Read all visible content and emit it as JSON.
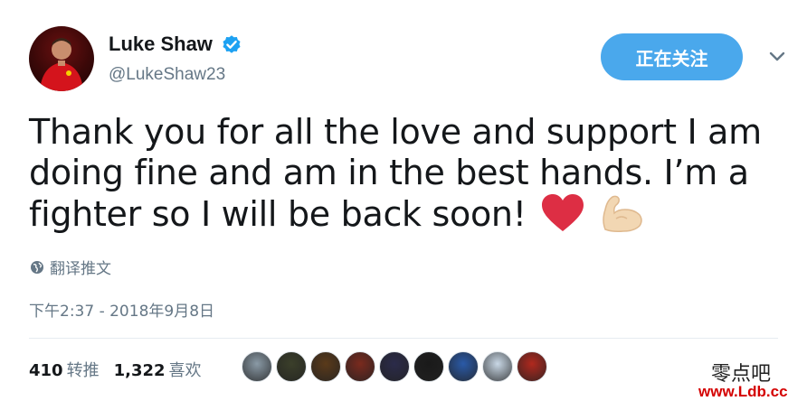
{
  "user": {
    "display_name": "Luke Shaw",
    "handle": "@LukeShaw23",
    "verified_icon": "verified-badge-icon"
  },
  "follow_button": {
    "label": "正在关注"
  },
  "tweet": {
    "text": "Thank you for all the love and support I am doing fine and am in the best hands. I’m a fighter so I will be back soon!",
    "emojis": [
      "red-heart-icon",
      "flexed-biceps-icon"
    ]
  },
  "translate": {
    "label": "翻译推文"
  },
  "timestamp": "下午2:37 - 2018年9月8日",
  "stats": {
    "retweets_count": "410",
    "retweets_label": "转推",
    "likes_count": "1,322",
    "likes_label": "喜欢"
  },
  "likers": [
    {
      "color": "#8a9aa6"
    },
    {
      "color": "#3b3f2a"
    },
    {
      "color": "#5a3a1a"
    },
    {
      "color": "#7a2a1e"
    },
    {
      "color": "#2b2b4a"
    },
    {
      "color": "#1a1a1a"
    },
    {
      "color": "#2a5aa8"
    },
    {
      "color": "#c9d8e6"
    },
    {
      "color": "#b0281e"
    }
  ],
  "watermark": {
    "chinese": "零点吧",
    "url": "www.Ldb.cc"
  },
  "colors": {
    "accent": "#4aa8ec",
    "verified": "#1da1f2",
    "secondary_text": "#657786"
  }
}
